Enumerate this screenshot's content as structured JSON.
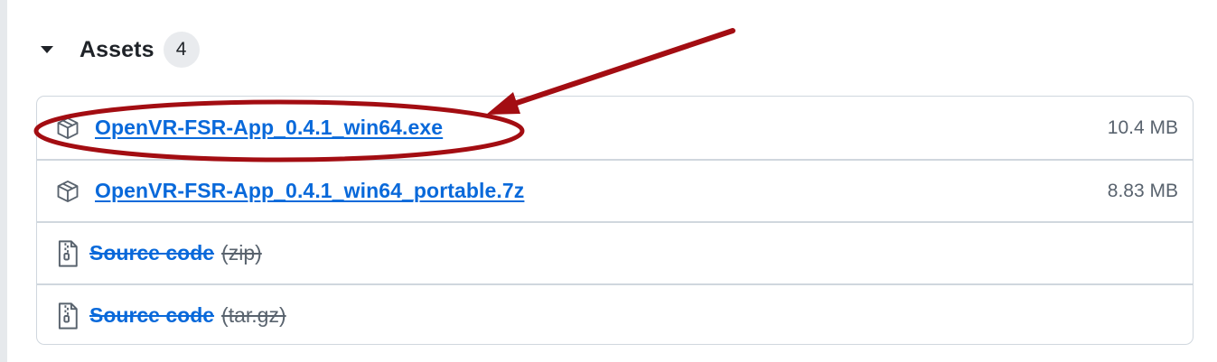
{
  "assets": {
    "title": "Assets",
    "count": "4",
    "items": [
      {
        "name": "OpenVR-FSR-App_0.4.1_win64.exe",
        "size": "10.4 MB",
        "icon": "package-icon"
      },
      {
        "name": "OpenVR-FSR-App_0.4.1_win64_portable.7z",
        "size": "8.83 MB",
        "icon": "package-icon"
      }
    ],
    "source": [
      {
        "label": "Source code",
        "format": "(zip)",
        "icon": "file-zip-icon"
      },
      {
        "label": "Source code",
        "format": "(tar.gz)",
        "icon": "file-zip-icon"
      }
    ]
  },
  "colors": {
    "link": "#0969da",
    "muted": "#59636e",
    "border": "#d0d7de",
    "annotation": "#a30d12"
  }
}
